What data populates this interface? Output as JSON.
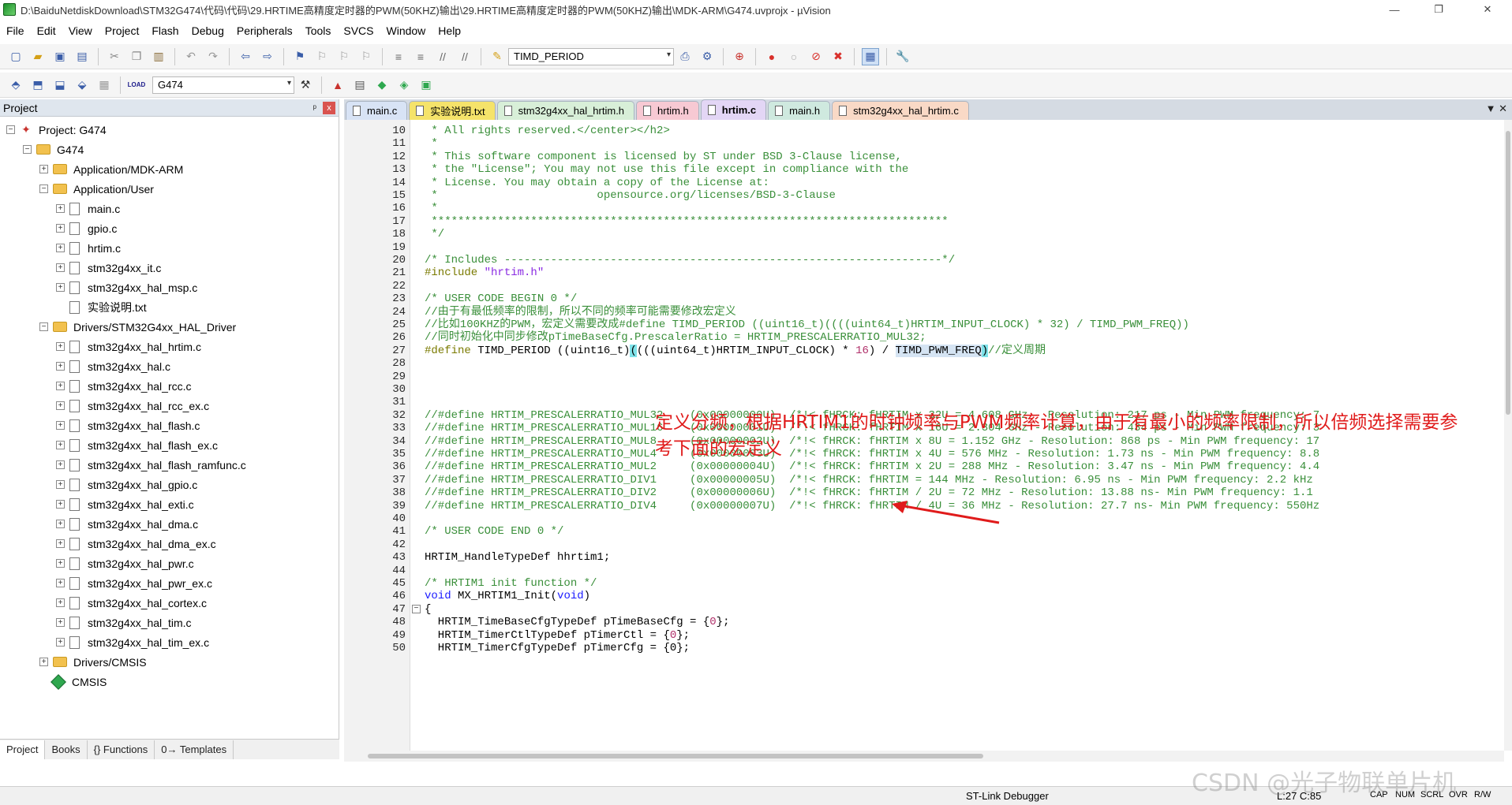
{
  "window": {
    "title": "D:\\BaiduNetdiskDownload\\STM32G474\\代码\\代码\\29.HRTIME高精度定时器的PWM(50KHZ)输出\\29.HRTIME高精度定时器的PWM(50KHZ)输出\\MDK-ARM\\G474.uvprojx - µVision",
    "controls": {
      "minimize": "—",
      "restore": "❐",
      "close": "✕"
    }
  },
  "menu": [
    "File",
    "Edit",
    "View",
    "Project",
    "Flash",
    "Debug",
    "Peripherals",
    "Tools",
    "SVCS",
    "Window",
    "Help"
  ],
  "toolbar": {
    "find_combo": "TIMD_PERIOD",
    "target_combo": "G474",
    "load_label": "LOAD"
  },
  "project_panel": {
    "title": "Project",
    "pin": "ᵖ",
    "close": "x",
    "tree": [
      {
        "label": "Project: G474",
        "toggle": "−",
        "kind": "project",
        "depth": 0
      },
      {
        "label": "G474",
        "toggle": "−",
        "kind": "folder",
        "depth": 1
      },
      {
        "label": "Application/MDK-ARM",
        "toggle": "+",
        "kind": "folder",
        "depth": 2
      },
      {
        "label": "Application/User",
        "toggle": "−",
        "kind": "folder",
        "depth": 2
      },
      {
        "label": "main.c",
        "toggle": "+",
        "kind": "file",
        "depth": 3
      },
      {
        "label": "gpio.c",
        "toggle": "+",
        "kind": "file",
        "depth": 3
      },
      {
        "label": "hrtim.c",
        "toggle": "+",
        "kind": "file",
        "depth": 3
      },
      {
        "label": "stm32g4xx_it.c",
        "toggle": "+",
        "kind": "file",
        "depth": 3
      },
      {
        "label": "stm32g4xx_hal_msp.c",
        "toggle": "+",
        "kind": "file",
        "depth": 3
      },
      {
        "label": "实验说明.txt",
        "toggle": "",
        "kind": "file",
        "depth": 3
      },
      {
        "label": "Drivers/STM32G4xx_HAL_Driver",
        "toggle": "−",
        "kind": "folder",
        "depth": 2
      },
      {
        "label": "stm32g4xx_hal_hrtim.c",
        "toggle": "+",
        "kind": "file",
        "depth": 3
      },
      {
        "label": "stm32g4xx_hal.c",
        "toggle": "+",
        "kind": "file",
        "depth": 3
      },
      {
        "label": "stm32g4xx_hal_rcc.c",
        "toggle": "+",
        "kind": "file",
        "depth": 3
      },
      {
        "label": "stm32g4xx_hal_rcc_ex.c",
        "toggle": "+",
        "kind": "file",
        "depth": 3
      },
      {
        "label": "stm32g4xx_hal_flash.c",
        "toggle": "+",
        "kind": "file",
        "depth": 3
      },
      {
        "label": "stm32g4xx_hal_flash_ex.c",
        "toggle": "+",
        "kind": "file",
        "depth": 3
      },
      {
        "label": "stm32g4xx_hal_flash_ramfunc.c",
        "toggle": "+",
        "kind": "file",
        "depth": 3
      },
      {
        "label": "stm32g4xx_hal_gpio.c",
        "toggle": "+",
        "kind": "file",
        "depth": 3
      },
      {
        "label": "stm32g4xx_hal_exti.c",
        "toggle": "+",
        "kind": "file",
        "depth": 3
      },
      {
        "label": "stm32g4xx_hal_dma.c",
        "toggle": "+",
        "kind": "file",
        "depth": 3
      },
      {
        "label": "stm32g4xx_hal_dma_ex.c",
        "toggle": "+",
        "kind": "file",
        "depth": 3
      },
      {
        "label": "stm32g4xx_hal_pwr.c",
        "toggle": "+",
        "kind": "file",
        "depth": 3
      },
      {
        "label": "stm32g4xx_hal_pwr_ex.c",
        "toggle": "+",
        "kind": "file",
        "depth": 3
      },
      {
        "label": "stm32g4xx_hal_cortex.c",
        "toggle": "+",
        "kind": "file",
        "depth": 3
      },
      {
        "label": "stm32g4xx_hal_tim.c",
        "toggle": "+",
        "kind": "file",
        "depth": 3
      },
      {
        "label": "stm32g4xx_hal_tim_ex.c",
        "toggle": "+",
        "kind": "file",
        "depth": 3
      },
      {
        "label": "Drivers/CMSIS",
        "toggle": "+",
        "kind": "folder",
        "depth": 2
      },
      {
        "label": "CMSIS",
        "toggle": "",
        "kind": "cmsis",
        "depth": 2
      }
    ],
    "bottom_tabs": [
      "Project",
      "Books",
      "{} Functions",
      "0→ Templates"
    ]
  },
  "editor": {
    "tabs": [
      {
        "label": "main.c",
        "color": "#d8e3f5"
      },
      {
        "label": "实验说明.txt",
        "color": "#f5e36a"
      },
      {
        "label": "stm32g4xx_hal_hrtim.h",
        "color": "#d8efd8"
      },
      {
        "label": "hrtim.h",
        "color": "#f7c9d3"
      },
      {
        "label": "hrtim.c",
        "color": "#e3d6f5",
        "active": true
      },
      {
        "label": "main.h",
        "color": "#cfe9df"
      },
      {
        "label": "stm32g4xx_hal_hrtim.c",
        "color": "#f9d9c6"
      }
    ],
    "tab_controls": "▼  ✕",
    "lines": [
      {
        "n": "10",
        "segs": [
          [
            "c",
            " * All rights reserved.</center></h2>"
          ]
        ]
      },
      {
        "n": "11",
        "segs": [
          [
            "c",
            " *"
          ]
        ]
      },
      {
        "n": "12",
        "segs": [
          [
            "c",
            " * This software component is licensed by ST under BSD 3-Clause license,"
          ]
        ]
      },
      {
        "n": "13",
        "segs": [
          [
            "c",
            " * the \"License\"; You may not use this file except in compliance with the"
          ]
        ]
      },
      {
        "n": "14",
        "segs": [
          [
            "c",
            " * License. You may obtain a copy of the License at:"
          ]
        ]
      },
      {
        "n": "15",
        "segs": [
          [
            "c",
            " *                        opensource.org/licenses/BSD-3-Clause"
          ]
        ]
      },
      {
        "n": "16",
        "segs": [
          [
            "c",
            " *"
          ]
        ]
      },
      {
        "n": "17",
        "segs": [
          [
            "c",
            " ******************************************************************************"
          ]
        ]
      },
      {
        "n": "18",
        "segs": [
          [
            "c",
            " */"
          ]
        ]
      },
      {
        "n": "19",
        "segs": []
      },
      {
        "n": "20",
        "segs": [
          [
            "c",
            "/* Includes ------------------------------------------------------------------*/"
          ]
        ]
      },
      {
        "n": "21",
        "segs": [
          [
            "p",
            "#include "
          ],
          [
            "s",
            "\"hrtim.h\""
          ]
        ]
      },
      {
        "n": "22",
        "segs": []
      },
      {
        "n": "23",
        "segs": [
          [
            "c",
            "/* USER CODE BEGIN 0 */"
          ]
        ]
      },
      {
        "n": "24",
        "segs": [
          [
            "c",
            "//由于有最低频率的限制，所以不同的频率可能需要修改宏定义"
          ]
        ]
      },
      {
        "n": "25",
        "segs": [
          [
            "c",
            "//比如100KHZ的PWM，宏定义需要改成#define TIMD_PERIOD ((uint16_t)((((uint64_t)HRTIM_INPUT_CLOCK) * 32) / TIMD_PWM_FREQ))"
          ]
        ]
      },
      {
        "n": "26",
        "segs": [
          [
            "c",
            "//同时初始化中同步修改pTimeBaseCfg.PrescalerRatio = HRTIM_PRESCALERRATIO_MUL32;"
          ]
        ]
      },
      {
        "n": "27",
        "segs": [
          [
            "p",
            "#define "
          ],
          [
            "x",
            "TIMD_PERIOD ((uint16_t)"
          ],
          [
            "h",
            "("
          ],
          [
            "x",
            "(((uint64_t)HRTIM_INPUT_CLOCK) * "
          ],
          [
            "n",
            "16"
          ],
          [
            "x",
            ") / "
          ],
          [
            "sel",
            "TIMD_PWM_FREQ"
          ],
          [
            "h",
            ")"
          ],
          [
            "c",
            "//定义周期"
          ]
        ]
      },
      {
        "n": "28",
        "segs": []
      },
      {
        "n": "29",
        "segs": []
      },
      {
        "n": "30",
        "segs": []
      },
      {
        "n": "31",
        "segs": []
      },
      {
        "n": "32",
        "segs": [
          [
            "c",
            "//#define HRTIM_PRESCALERRATIO_MUL32    (0x00000000U)  /*!< fHRCK: fHRTIM x 32U = 4.608 GHz - Resolution: 217 ps - Min PWM frequency: 7"
          ]
        ]
      },
      {
        "n": "33",
        "segs": [
          [
            "c",
            "//#define HRTIM_PRESCALERRATIO_MUL16    (0x00000001U)  /*!< fHRCK: fHRTIM x 16U = 2.304 GHz - Resolution: 434 ps - Min PWM frequency: 3"
          ]
        ]
      },
      {
        "n": "34",
        "segs": [
          [
            "c",
            "//#define HRTIM_PRESCALERRATIO_MUL8     (0x00000002U)  /*!< fHRCK: fHRTIM x 8U = 1.152 GHz - Resolution: 868 ps - Min PWM frequency: 17"
          ]
        ]
      },
      {
        "n": "35",
        "segs": [
          [
            "c",
            "//#define HRTIM_PRESCALERRATIO_MUL4     (0x00000003U)  /*!< fHRCK: fHRTIM x 4U = 576 MHz - Resolution: 1.73 ns - Min PWM frequency: 8.8"
          ]
        ]
      },
      {
        "n": "36",
        "segs": [
          [
            "c",
            "//#define HRTIM_PRESCALERRATIO_MUL2     (0x00000004U)  /*!< fHRCK: fHRTIM x 2U = 288 MHz - Resolution: 3.47 ns - Min PWM frequency: 4.4"
          ]
        ]
      },
      {
        "n": "37",
        "segs": [
          [
            "c",
            "//#define HRTIM_PRESCALERRATIO_DIV1     (0x00000005U)  /*!< fHRCK: fHRTIM = 144 MHz - Resolution: 6.95 ns - Min PWM frequency: 2.2 kHz"
          ]
        ]
      },
      {
        "n": "38",
        "segs": [
          [
            "c",
            "//#define HRTIM_PRESCALERRATIO_DIV2     (0x00000006U)  /*!< fHRCK: fHRTIM / 2U = 72 MHz - Resolution: 13.88 ns- Min PWM frequency: 1.1"
          ]
        ]
      },
      {
        "n": "39",
        "segs": [
          [
            "c",
            "//#define HRTIM_PRESCALERRATIO_DIV4     (0x00000007U)  /*!< fHRCK: fHRTIM / 4U = 36 MHz - Resolution: 27.7 ns- Min PWM frequency: 550Hz"
          ]
        ]
      },
      {
        "n": "40",
        "segs": []
      },
      {
        "n": "41",
        "segs": [
          [
            "c",
            "/* USER CODE END 0 */"
          ]
        ]
      },
      {
        "n": "42",
        "segs": []
      },
      {
        "n": "43",
        "segs": [
          [
            "x",
            "HRTIM_HandleTypeDef hhrtim1;"
          ]
        ]
      },
      {
        "n": "44",
        "segs": []
      },
      {
        "n": "45",
        "segs": [
          [
            "c",
            "/* HRTIM1 init function */"
          ]
        ]
      },
      {
        "n": "46",
        "segs": [
          [
            "k",
            "void "
          ],
          [
            "x",
            "MX_HRTIM1_Init("
          ],
          [
            "k",
            "void"
          ],
          [
            "x",
            ")"
          ]
        ]
      },
      {
        "n": "47",
        "segs": [
          [
            "x",
            "{"
          ]
        ],
        "fold": "−"
      },
      {
        "n": "48",
        "segs": [
          [
            "x",
            "  HRTIM_TimeBaseCfgTypeDef pTimeBaseCfg = {"
          ],
          [
            "n",
            "0"
          ],
          [
            "x",
            "};"
          ]
        ]
      },
      {
        "n": "49",
        "segs": [
          [
            "x",
            "  HRTIM_TimerCtlTypeDef pTimerCtl = {"
          ],
          [
            "n",
            "0"
          ],
          [
            "x",
            "};"
          ]
        ]
      },
      {
        "n": "50",
        "segs": [
          [
            "x",
            "  HRTIM_TimerCfgTypeDef pTimerCfg = {0};"
          ]
        ]
      }
    ],
    "annotation": "定义分频，根据HRTIM1的时钟频率与PWM频率计算，由于有最小的频率限制，所以倍频选择需要参考下面的宏定义"
  },
  "status": {
    "debugger": "ST-Link Debugger",
    "position": "L:27 C:85",
    "caps": "CAP",
    "num": "NUM",
    "scrl": "SCRL",
    "ovr": "OVR",
    "rw": "R/W"
  },
  "watermark": "CSDN @光子物联单片机"
}
